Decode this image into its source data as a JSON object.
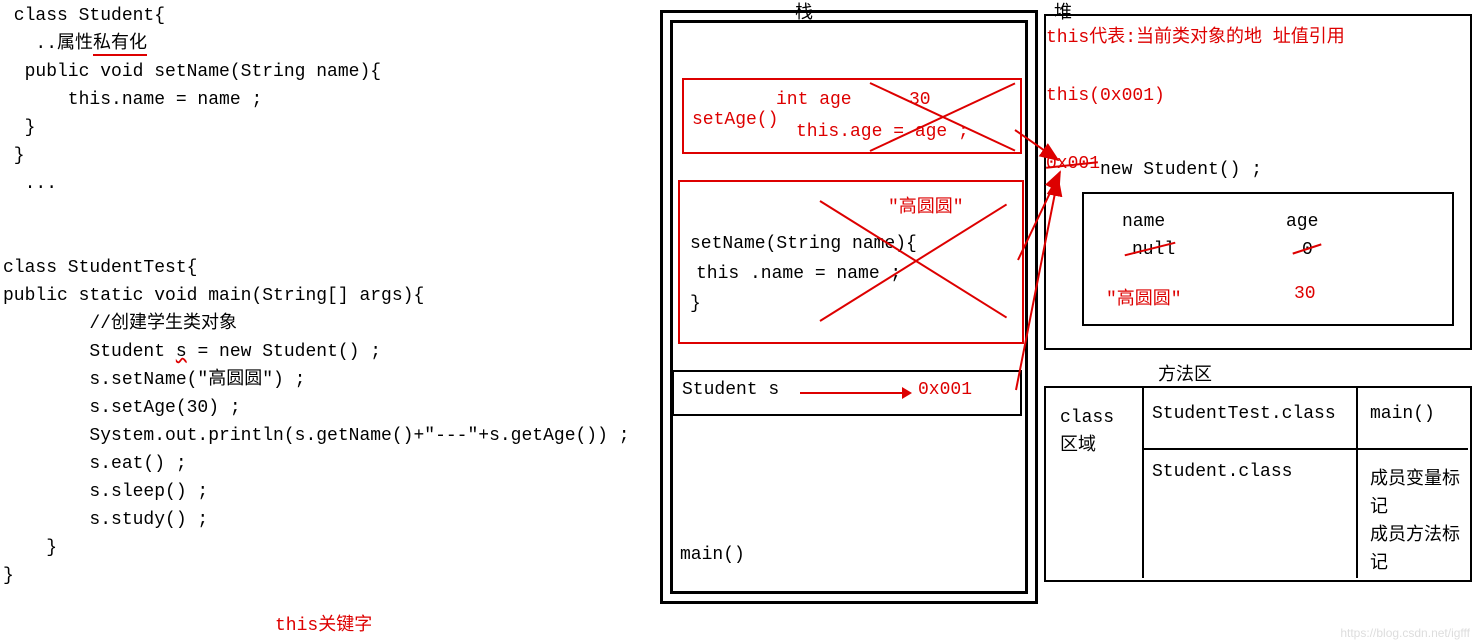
{
  "code": {
    "line1": " class Student{",
    "line2_a": "   ..属性",
    "line2_b": "私有化",
    "line3": "  public void setName(String name){",
    "line4": "      this.name = name ;",
    "line5": "  }",
    "line6": " }",
    "line7": "  ...",
    "line8": "",
    "line9": "",
    "line10": "class StudentTest{",
    "line11": "public static void main(String[] args){",
    "line12": "        //创建学生类对象",
    "line13a": "        Student ",
    "line13b": "s",
    "line13c": " = new Student() ;",
    "line14": "        s.setName(\"高圆圆\") ;",
    "line15": "        s.setAge(30) ;",
    "line16": "        System.out.println(s.getName()+\"---\"+s.getAge()) ;",
    "line17": "        s.eat() ;",
    "line18": "        s.sleep() ;",
    "line19": "        s.study() ;",
    "line20": "    }",
    "line21": "}"
  },
  "this_keyword": "this关键字",
  "stack": {
    "title": "栈",
    "setAge": {
      "label": "setAge()",
      "var": "int age",
      "value": "30",
      "assign": "this.age = age ;"
    },
    "setName": {
      "gyy": "\"高圆圆\"",
      "line1": "setName(String name){",
      "line2": " this .name = name ;",
      "line3": "}"
    },
    "studentS": {
      "text": "Student s",
      "addr": "0x001"
    },
    "main": "main()"
  },
  "heap": {
    "title": "堆",
    "desc": "this代表:当前类对象的地 址值引用",
    "thisAddr": "this(0x001)",
    "addr": "0x001",
    "newStmt": "new Student() ;",
    "obj": {
      "nameLabel": "name",
      "ageLabel": "age",
      "nullVal": "null",
      "zeroVal": "0",
      "gyy": "\"高圆圆\"",
      "thirty": "30"
    }
  },
  "methodArea": {
    "title": "方法区",
    "classLabel": "class\n区域",
    "stc": "StudentTest.class",
    "sc": "Student.class",
    "main": "main()",
    "members": "成员变量标\n记\n成员方法标\n记"
  },
  "watermark": "https://blog.csdn.net/igfff"
}
